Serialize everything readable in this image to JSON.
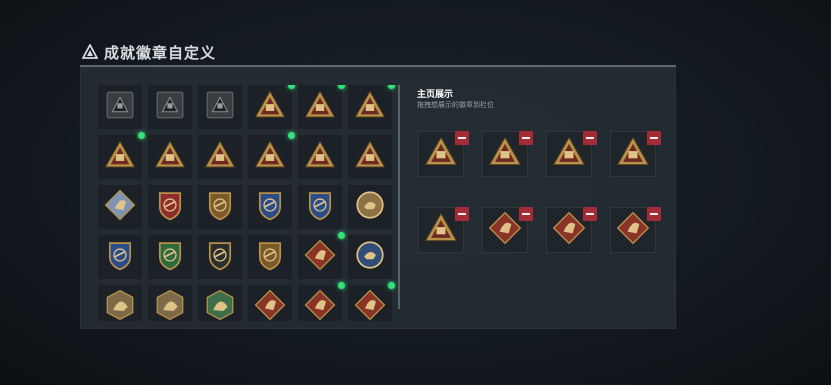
{
  "title": "成就徽章自定义",
  "showcase": {
    "title": "主页展示",
    "hint": "拖拽想展示的徽章到栏位",
    "slots": [
      {
        "icon": "triangle-crate"
      },
      {
        "icon": "triangle-tank"
      },
      {
        "icon": "triangle-medkit"
      },
      {
        "icon": "triangle-skull"
      },
      {
        "icon": "triangle-56"
      },
      {
        "icon": "diamond-wolf"
      },
      {
        "icon": "diamond-wolf"
      },
      {
        "icon": "diamond-wolf"
      }
    ]
  },
  "badges": [
    {
      "icon": "square-triangle-gray",
      "new": false
    },
    {
      "icon": "square-helicopter-gray",
      "new": false
    },
    {
      "icon": "square-wings-gray",
      "new": false
    },
    {
      "icon": "triangle-wings",
      "new": true
    },
    {
      "icon": "triangle-medkit",
      "new": true
    },
    {
      "icon": "triangle-bag",
      "new": true
    },
    {
      "icon": "triangle-helmet",
      "new": true
    },
    {
      "icon": "triangle-soldier",
      "new": false
    },
    {
      "icon": "triangle-knife",
      "new": false
    },
    {
      "icon": "triangle-crate",
      "new": true
    },
    {
      "icon": "triangle-skull",
      "new": false
    },
    {
      "icon": "triangle-soldiers",
      "new": false
    },
    {
      "icon": "diamond-blue",
      "new": false
    },
    {
      "icon": "shield-red-laurel",
      "new": false
    },
    {
      "icon": "shield-gold",
      "new": false
    },
    {
      "icon": "shield-blue-stars",
      "new": false
    },
    {
      "icon": "shield-blue-wings",
      "new": false
    },
    {
      "icon": "circle-gold",
      "new": false
    },
    {
      "icon": "shield-blue-aircraft",
      "new": false
    },
    {
      "icon": "shield-green-aircraft",
      "new": false
    },
    {
      "icon": "shield-dark-sword",
      "new": false
    },
    {
      "icon": "shield-gold-eagle",
      "new": false
    },
    {
      "icon": "diamond-wolf",
      "new": true
    },
    {
      "icon": "circle-blue-wolf",
      "new": false
    },
    {
      "icon": "hexagon-dragon",
      "new": false
    },
    {
      "icon": "hexagon-eagle",
      "new": false
    },
    {
      "icon": "hexagon-green-wolf",
      "new": false
    },
    {
      "icon": "diamond-wolf",
      "new": false
    },
    {
      "icon": "diamond-wolf",
      "new": true
    },
    {
      "icon": "diamond-wolf",
      "new": true
    }
  ]
}
